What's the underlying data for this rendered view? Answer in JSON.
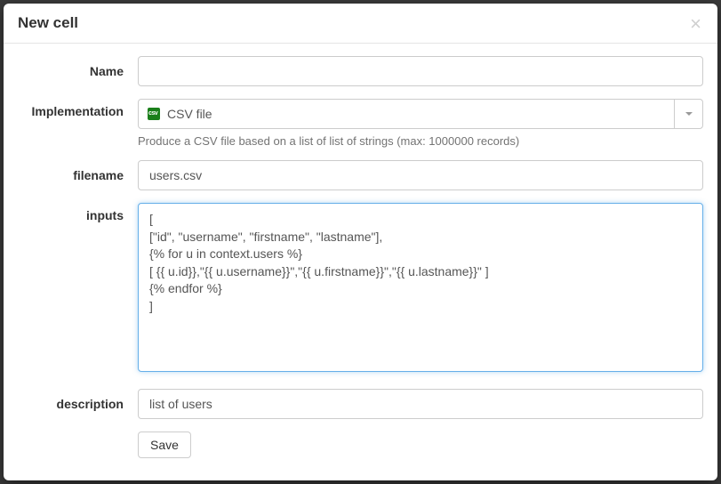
{
  "modal": {
    "title": "New cell"
  },
  "form": {
    "name": {
      "label": "Name",
      "value": ""
    },
    "implementation": {
      "label": "Implementation",
      "selected": "CSV file",
      "help": "Produce a CSV file based on a list of list of strings (max: 1000000 records)"
    },
    "filename": {
      "label": "filename",
      "value": "users.csv"
    },
    "inputs": {
      "label": "inputs",
      "value": "[\n[\"id\", \"username\", \"firstname\", \"lastname\"],\n{% for u in context.users %}\n[ {{ u.id}},\"{{ u.username}}\",\"{{ u.firstname}}\",\"{{ u.lastname}}\" ]\n{% endfor %}\n]"
    },
    "description": {
      "label": "description",
      "value": "list of users"
    },
    "save_label": "Save"
  }
}
